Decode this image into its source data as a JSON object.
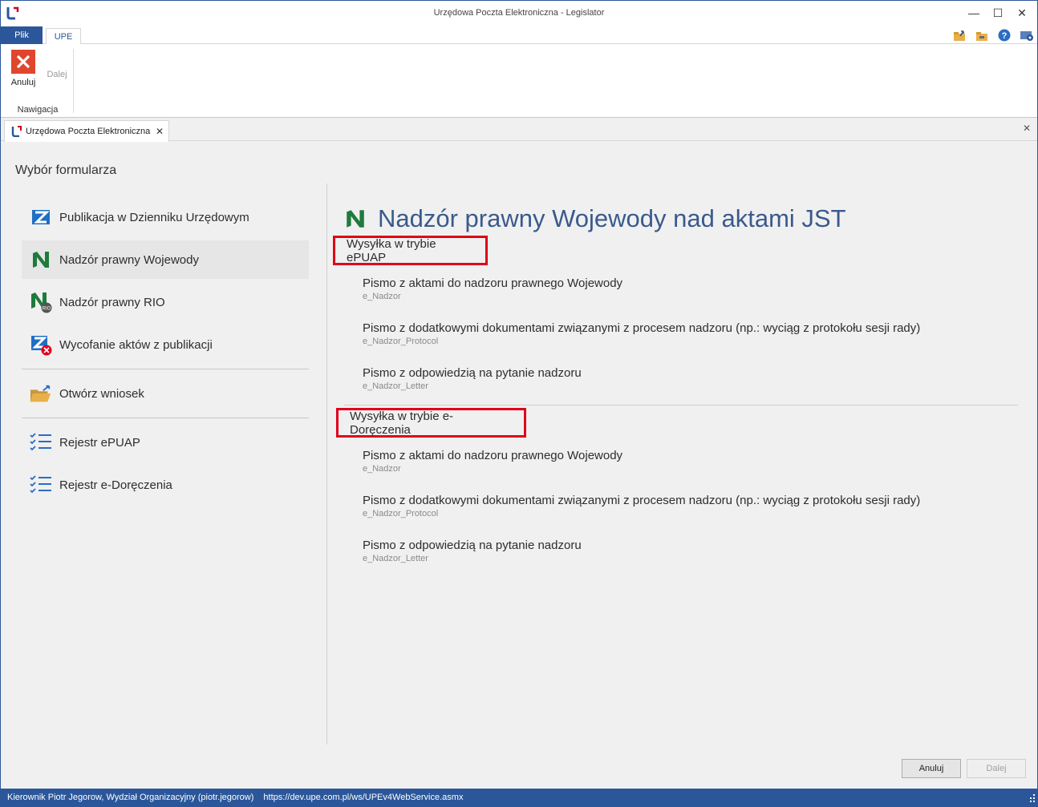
{
  "window": {
    "title": "Urzędowa Poczta Elektroniczna - Legislator",
    "minimize_glyph": "—",
    "maximize_glyph": "☐",
    "close_glyph": "✕"
  },
  "ribbon": {
    "tabs": [
      {
        "label": "Plik"
      },
      {
        "label": "UPE"
      }
    ],
    "buttons": {
      "cancel_label": "Anuluj",
      "next_label": "Dalej"
    },
    "group_label": "Nawigacja"
  },
  "document_tab": {
    "label": "Urzędowa Poczta Elektroniczna",
    "close_glyph": "✕"
  },
  "main": {
    "section_title": "Wybór formularza",
    "nav": [
      {
        "label": "Publikacja w Dzienniku Urzędowym",
        "icon": "dziennik-icon"
      },
      {
        "label": "Nadzór prawny Wojewody",
        "icon": "nadzor-wojewody-icon",
        "active": true
      },
      {
        "label": "Nadzór prawny RIO",
        "icon": "nadzor-rio-icon"
      },
      {
        "label": "Wycofanie aktów z publikacji",
        "icon": "wycofanie-icon"
      },
      {
        "label": "Otwórz wniosek",
        "icon": "open-folder-icon"
      },
      {
        "label": "Rejestr ePUAP",
        "icon": "checklist-icon"
      },
      {
        "label": "Rejestr e-Doręczenia",
        "icon": "checklist-icon"
      }
    ],
    "right": {
      "title": "Nadzór prawny Wojewody nad aktami JST",
      "modes": [
        {
          "label": "Wysyłka w trybie ePUAP",
          "forms": [
            {
              "title": "Pismo z aktami do nadzoru prawnego Wojewody",
              "code": "e_Nadzor"
            },
            {
              "title": "Pismo z dodatkowymi dokumentami związanymi z procesem nadzoru (np.: wyciąg z protokołu sesji rady)",
              "code": "e_Nadzor_Protocol"
            },
            {
              "title": "Pismo z odpowiedzią na pytanie nadzoru",
              "code": "e_Nadzor_Letter"
            }
          ]
        },
        {
          "label": "Wysyłka w trybie e-Doręczenia",
          "forms": [
            {
              "title": "Pismo z aktami do nadzoru prawnego Wojewody",
              "code": "e_Nadzor"
            },
            {
              "title": "Pismo z dodatkowymi dokumentami związanymi z procesem nadzoru (np.: wyciąg z protokołu sesji rady)",
              "code": "e_Nadzor_Protocol"
            },
            {
              "title": "Pismo z odpowiedzią na pytanie nadzoru",
              "code": "e_Nadzor_Letter"
            }
          ]
        }
      ]
    },
    "buttons": {
      "cancel_label": "Anuluj",
      "next_label": "Dalej"
    }
  },
  "statusbar": {
    "user": "Kierownik Piotr Jegorow, Wydział Organizacyjny (piotr.jegorow)",
    "url": "https://dev.upe.com.pl/ws/UPEv4WebService.asmx"
  },
  "colors": {
    "accent": "#2b579a",
    "highlight_box": "#e0001b",
    "title_text": "#3a5a8c",
    "nadzor_green": "#1e7b3b"
  }
}
